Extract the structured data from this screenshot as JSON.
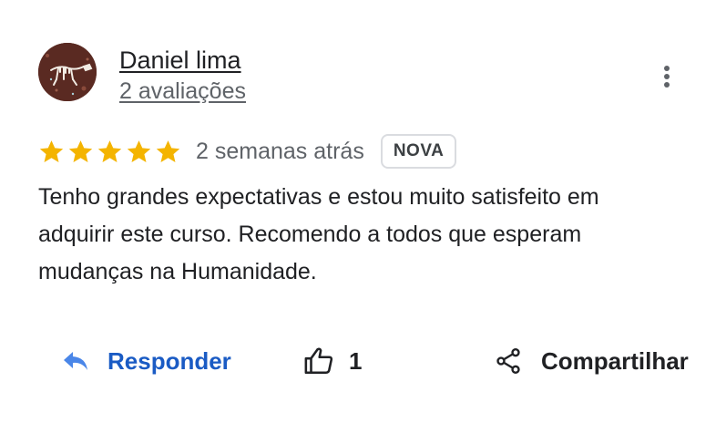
{
  "author": {
    "name": "Daniel lima",
    "reviews_count": "2 avaliações"
  },
  "rating": {
    "stars": 5,
    "max_stars": 5,
    "star_color": "#f4b400"
  },
  "date": "2 semanas atrás",
  "badge": "NOVA",
  "text": "Tenho grandes expectativas e estou muito satisfeito em adquirir este curso. Recomendo a todos que esperam mudanças na Humanidade.",
  "actions": {
    "reply_label": "Responder",
    "like_count": "1",
    "share_label": "Compartilhar"
  },
  "colors": {
    "link_blue": "#1a5bc4",
    "text_primary": "#202124",
    "text_secondary": "#5f6368",
    "badge_border": "#dadce0"
  },
  "icons": {
    "more": "more-vertical-icon",
    "reply": "reply-icon",
    "like": "thumbs-up-icon",
    "share": "share-icon"
  }
}
